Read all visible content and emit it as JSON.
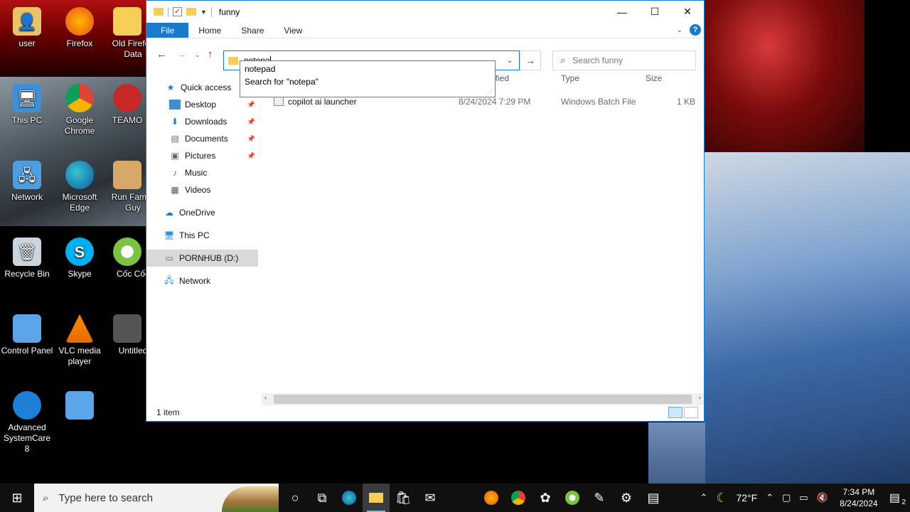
{
  "desktop": {
    "icons": [
      {
        "label": "user"
      },
      {
        "label": "Firefox"
      },
      {
        "label": "Old Firefox Data"
      },
      {
        "label": "This PC"
      },
      {
        "label": "Google Chrome"
      },
      {
        "label": "TEAMO"
      },
      {
        "label": "Network"
      },
      {
        "label": "Microsoft Edge"
      },
      {
        "label": "Run Family Guy"
      },
      {
        "label": "Recycle Bin"
      },
      {
        "label": "Skype"
      },
      {
        "label": "Cốc Cốc"
      },
      {
        "label": "Control Panel"
      },
      {
        "label": "VLC media player"
      },
      {
        "label": "Untitled"
      },
      {
        "label": "Advanced SystemCare 8"
      }
    ]
  },
  "window": {
    "title": "funny",
    "controls": {
      "minimize": "—",
      "maximize": "☐",
      "close": "✕"
    },
    "ribbon_tabs": [
      "File",
      "Home",
      "Share",
      "View"
    ],
    "address_value": "notepa",
    "search_placeholder": "Search funny",
    "autocomplete": [
      "notepad",
      "Search for \"notepa\""
    ],
    "sidebar": [
      {
        "label": "Quick access"
      },
      {
        "label": "Desktop"
      },
      {
        "label": "Downloads"
      },
      {
        "label": "Documents"
      },
      {
        "label": "Pictures"
      },
      {
        "label": "Music"
      },
      {
        "label": "Videos"
      },
      {
        "label": "OneDrive"
      },
      {
        "label": "This PC"
      },
      {
        "label": "PORNHUB (D:)"
      },
      {
        "label": "Network"
      }
    ],
    "columns": {
      "modified": "ified",
      "type": "Type",
      "size": "Size"
    },
    "files": [
      {
        "name": "copilot ai launcher",
        "modified": "8/24/2024 7:29 PM",
        "type": "Windows Batch File",
        "size": "1 KB"
      }
    ],
    "status": "1 item"
  },
  "taskbar": {
    "search_placeholder": "Type here to search",
    "weather": "72°F",
    "time": "7:34 PM",
    "date": "8/24/2024",
    "notifications": "2"
  }
}
